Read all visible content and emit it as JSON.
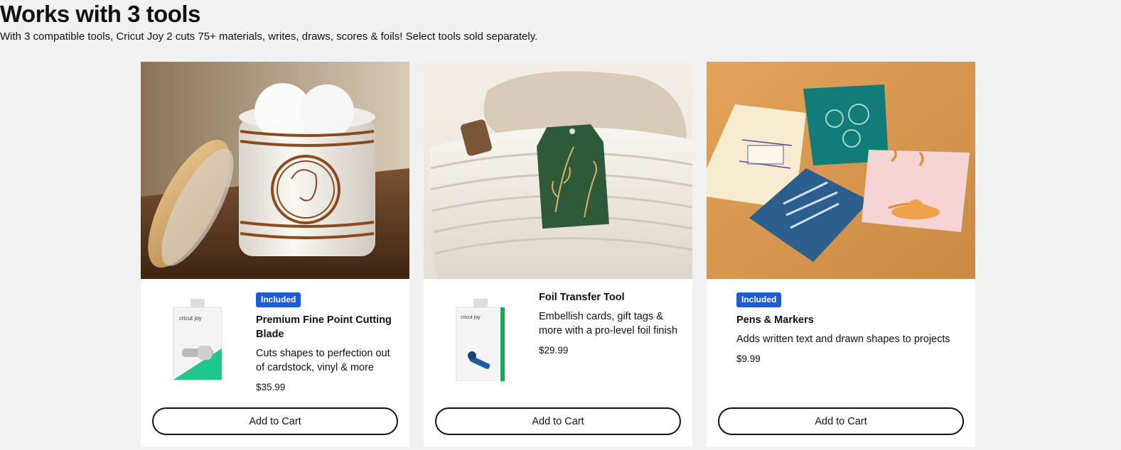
{
  "section": {
    "title": "Works with 3 tools",
    "subtitle": "With 3 compatible tools, Cricut Joy 2 cuts 75+ materials, writes, draws, scores & foils! Select tools sold separately."
  },
  "products": [
    {
      "badge": "Included",
      "name": "Premium Fine Point Cutting Blade",
      "description": "Cuts shapes to perfection out of cardstock, vinyl & more",
      "price": "$35.99",
      "cta": "Add to Cart",
      "thumb_brand": "cricut joy"
    },
    {
      "badge": "",
      "name": "Foil Transfer Tool",
      "description": "Embellish cards, gift tags & more with a pro-level foil finish",
      "price": "$29.99",
      "cta": "Add to Cart",
      "thumb_brand": "cricut joy"
    },
    {
      "badge": "Included",
      "name": "Pens & Markers",
      "description": "Adds written text and drawn shapes to projects",
      "price": "$9.99",
      "cta": "Add to Cart"
    }
  ],
  "colors": {
    "page_bg": "#f1f1f1",
    "badge": "#1e5bd6",
    "text": "#111111"
  }
}
